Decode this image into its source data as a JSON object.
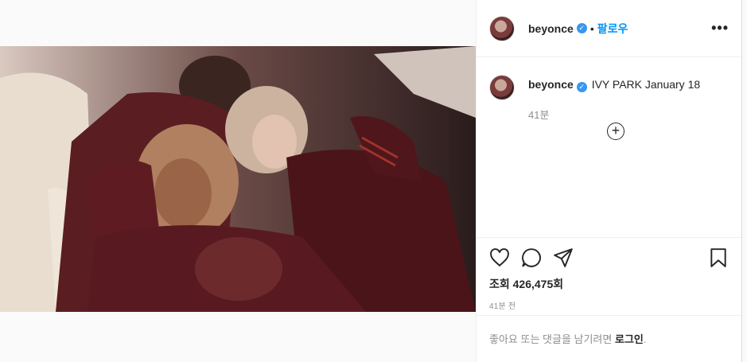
{
  "post": {
    "username": "beyonce",
    "dot": "•",
    "follow_label": "팔로우",
    "more_label": "•••",
    "verified_mark": "✓",
    "caption_text": "IVY PARK January 18",
    "caption_time": "41분",
    "add_comment_icon": "+",
    "views_label": "조회 426,475회",
    "posted_time": "41분 전",
    "login_prompt": "좋아요 또는 댓글을 남기려면",
    "login_link": "로그인",
    "login_suffix": "."
  },
  "icons": {
    "like": "heart-icon",
    "comment": "comment-icon",
    "share": "share-icon",
    "save": "bookmark-icon",
    "more": "more-options-icon"
  },
  "colors": {
    "accent": "#0095f6",
    "verified": "#3897f0",
    "text": "#262626",
    "muted": "#8e8e8e"
  }
}
